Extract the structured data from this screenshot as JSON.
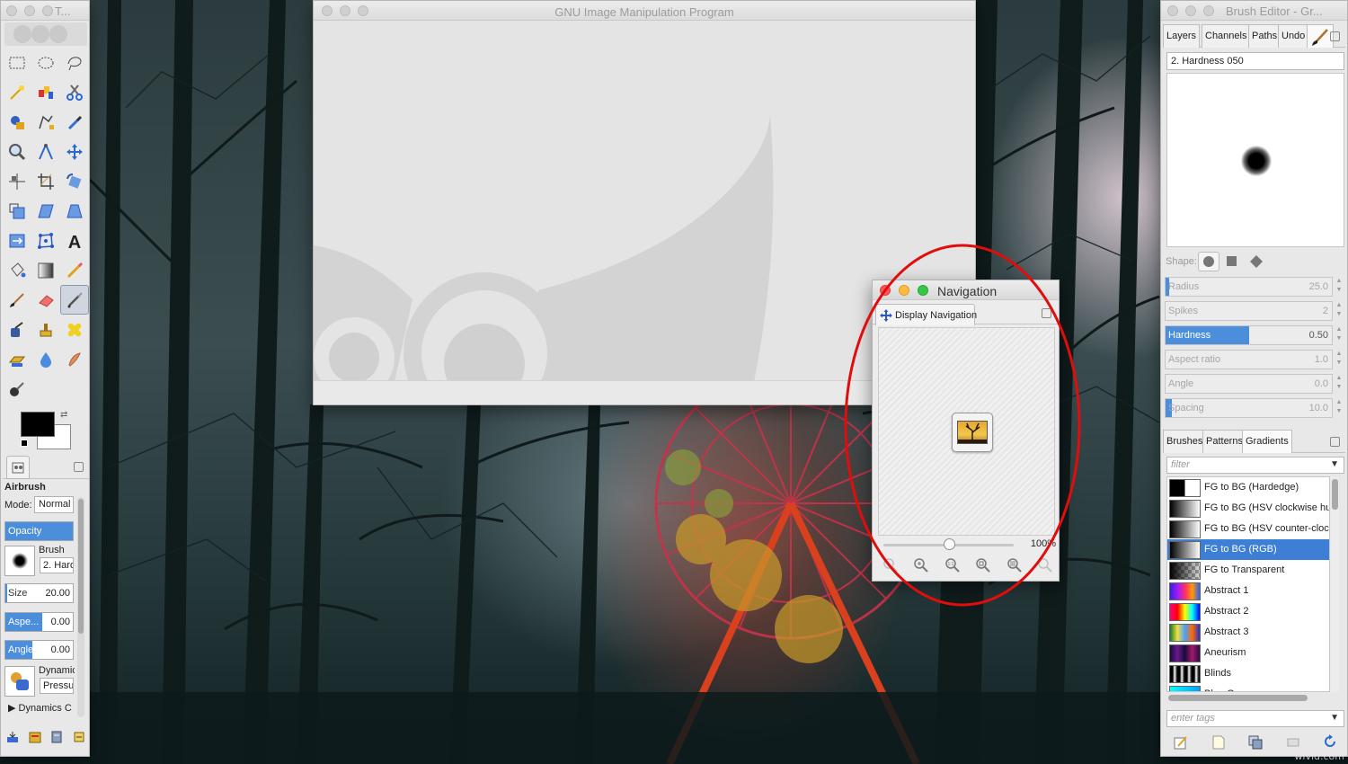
{
  "toolbox": {
    "title": "T...",
    "tool_name": "Airbrush",
    "mode_label": "Mode:",
    "mode_value": "Normal",
    "opacity_label": "Opacity",
    "brush_label": "Brush",
    "brush_value": "2. Hard",
    "size_label": "Size",
    "size_value": "20.00",
    "aspect_label": "Aspe...",
    "aspect_value": "0.00",
    "angle_label": "Angle",
    "angle_value": "0.00",
    "dynamics_label": "Dynamic",
    "dynamics_value": "Pressu",
    "dynamics_options": "Dynamics C",
    "fg_color": "#000000",
    "bg_color": "#ffffff",
    "tools": [
      "rect-select-icon",
      "ellipse-select-icon",
      "lasso-icon",
      "fuzzy-select-icon",
      "color-select-icon",
      "scissors-icon",
      "foreground-select-icon",
      "paths-icon",
      "color-picker-icon",
      "zoom-icon",
      "measure-icon",
      "move-icon",
      "align-icon",
      "crop-icon",
      "rotate-icon",
      "scale-icon",
      "shear-icon",
      "perspective-icon",
      "flip-icon",
      "cage-icon",
      "text-icon",
      "bucket-fill-icon",
      "blend-icon",
      "pencil-icon",
      "paintbrush-icon",
      "eraser-icon",
      "airbrush-icon",
      "ink-icon",
      "clone-icon",
      "heal-icon",
      "perspective-clone-icon",
      "blur-icon",
      "smudge-icon",
      "dodge-burn-icon"
    ],
    "active_tool": "airbrush-icon"
  },
  "main_window": {
    "title": "GNU Image Manipulation Program"
  },
  "navigation": {
    "title": "Navigation",
    "tab_label": "Display Navigation",
    "zoom_value": "100%",
    "zoom_fraction": 0.5
  },
  "dock": {
    "title": "Brush Editor - Gr...",
    "top_tabs": [
      "Layers",
      "Channels",
      "Paths",
      "Undo"
    ],
    "brush_name": "2. Hardness 050",
    "shape_label": "Shape:",
    "sliders": [
      {
        "label": "Radius",
        "value": "25.0",
        "fraction": 0.02,
        "active": false
      },
      {
        "label": "Spikes",
        "value": "2",
        "fraction": 0.0,
        "active": false
      },
      {
        "label": "Hardness",
        "value": "0.50",
        "fraction": 0.5,
        "active": true
      },
      {
        "label": "Aspect ratio",
        "value": "1.0",
        "fraction": 0.0,
        "active": false
      },
      {
        "label": "Angle",
        "value": "0.0",
        "fraction": 0.0,
        "active": false
      },
      {
        "label": "Spacing",
        "value": "10.0",
        "fraction": 0.04,
        "active": false
      }
    ],
    "bottom_tabs": [
      "Brushes",
      "Patterns",
      "Gradients"
    ],
    "active_bottom_tab": "Gradients",
    "filter_placeholder": "filter",
    "tags_placeholder": "enter tags",
    "gradients": [
      {
        "name": "FG to BG (Hardedge)",
        "swatch": "linear-gradient(90deg,#000 0 50%,#fff 50% 100%)",
        "selected": false
      },
      {
        "name": "FG to BG (HSV clockwise hue)",
        "swatch": "linear-gradient(90deg,#000,#fff)",
        "selected": false
      },
      {
        "name": "FG to BG (HSV counter-clockwise)",
        "swatch": "linear-gradient(90deg,#000,#fff)",
        "selected": false
      },
      {
        "name": "FG to BG (RGB)",
        "swatch": "linear-gradient(90deg,#000,#fff)",
        "selected": true
      },
      {
        "name": "FG to Transparent",
        "swatch": "linear-gradient(90deg,#000,rgba(0,0,0,0)),repeating-conic-gradient(#999 0 25%,#ddd 0 50%) 0 0/8px 8px",
        "selected": false
      },
      {
        "name": "Abstract 1",
        "swatch": "linear-gradient(90deg,#3a1fd6,#9b1cff,#ff2a6d,#ff9a00,#2a5cff)",
        "selected": false
      },
      {
        "name": "Abstract 2",
        "swatch": "linear-gradient(90deg,#ff0080,#ff0000,#ffff00,#00ffff,#0000ff)",
        "selected": false
      },
      {
        "name": "Abstract 3",
        "swatch": "linear-gradient(90deg,#1a7a2a,#f0e040,#4aa0ff,#ff6a00,#2030d0)",
        "selected": false
      },
      {
        "name": "Aneurism",
        "swatch": "linear-gradient(90deg,#1b0a3b,#6a1a8a,#1a0a3a,#a01a6a,#2a0a4a)",
        "selected": false
      },
      {
        "name": "Blinds",
        "swatch": "repeating-linear-gradient(90deg,#000 0 3px,#fff 5px,#000 8px)",
        "selected": false
      },
      {
        "name": "Blue Green",
        "swatch": "linear-gradient(90deg,#00ffff,#00a0ff)",
        "selected": false
      }
    ]
  },
  "watermark": "wlvid.com"
}
